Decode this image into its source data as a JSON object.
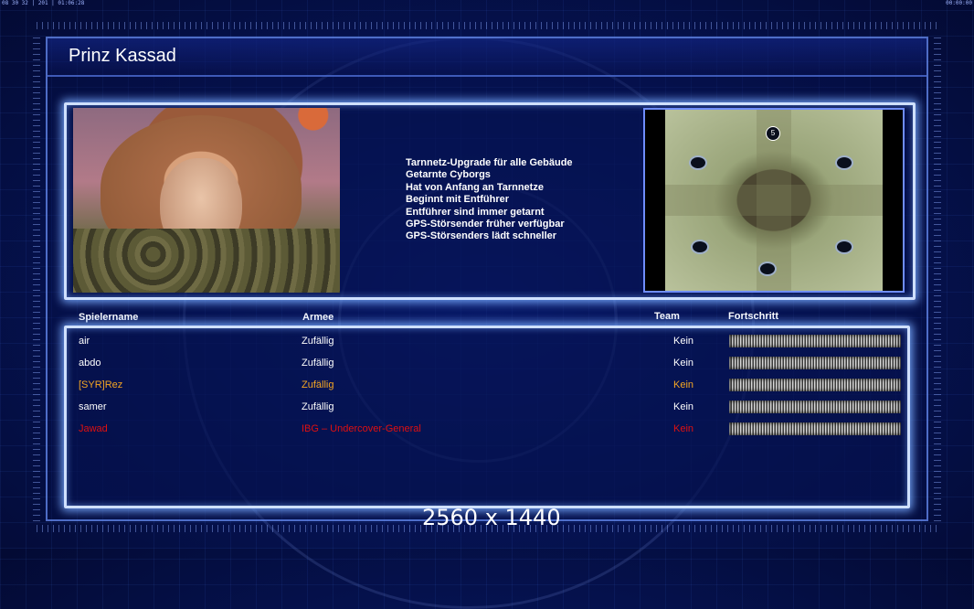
{
  "hud": {
    "clock_left": "08 30 32 | 201 | 01:06:28",
    "clock_right": "00:00:00"
  },
  "general": {
    "name": "Prinz Kassad"
  },
  "features": [
    "Tarnnetz-Upgrade für alle Gebäude",
    "Getarnte Cyborgs",
    "Hat von Anfang an Tarnnetze",
    "Beginnt mit Entführer",
    "Entführer sind immer getarnt",
    "GPS-Störsender früher verfügbar",
    "GPS-Störsenders lädt schneller"
  ],
  "map": {
    "start_marker": "5"
  },
  "table": {
    "headers": {
      "player": "Spielername",
      "army": "Armee",
      "team": "Team",
      "progress": "Fortschritt"
    },
    "rows": [
      {
        "player": "air",
        "army": "Zufällig",
        "team": "Kein",
        "color": "#ffffff"
      },
      {
        "player": "abdo",
        "army": "Zufällig",
        "team": "Kein",
        "color": "#ffffff"
      },
      {
        "player": "[SYR]Rez",
        "army": "Zufällig",
        "team": "Kein",
        "color": "#f5a623"
      },
      {
        "player": "samer",
        "army": "Zufällig",
        "team": "Kein",
        "color": "#ffffff"
      },
      {
        "player": "Jawad",
        "army": "IBG – Undercover-General",
        "team": "Kein",
        "color": "#e01010"
      }
    ]
  },
  "resolution": "2560 x 1440",
  "colors": {
    "panel_glow": "#cfe0ff",
    "background": "#061457"
  }
}
